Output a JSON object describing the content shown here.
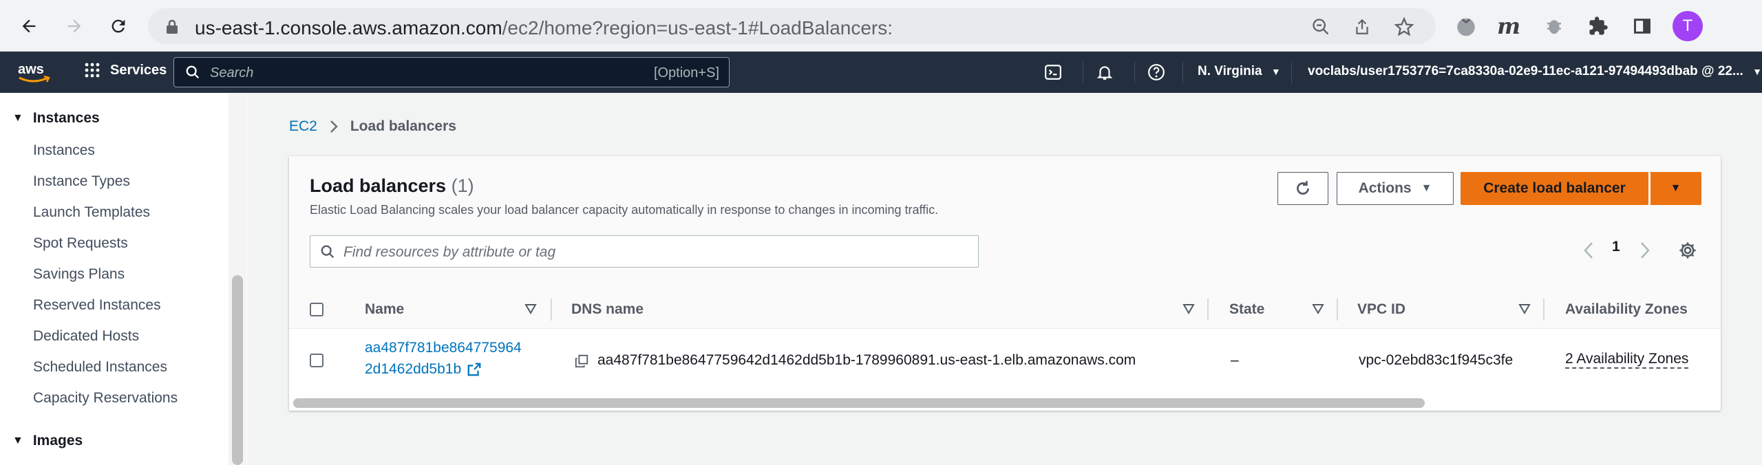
{
  "browser": {
    "url_host": "us-east-1.console.aws.amazon.com",
    "url_path": "/ec2/home?region=us-east-1#LoadBalancers:",
    "avatar_letter": "T"
  },
  "aws_nav": {
    "services_label": "Services",
    "search_placeholder": "Search",
    "search_shortcut": "[Option+S]",
    "region_label": "N. Virginia",
    "account_label": "voclabs/user1753776=7ca8330a-02e9-11ec-a121-97494493dbab @ 22..."
  },
  "sidebar": {
    "section_instances": "Instances",
    "items": [
      "Instances",
      "Instance Types",
      "Launch Templates",
      "Spot Requests",
      "Savings Plans",
      "Reserved Instances",
      "Dedicated Hosts",
      "Scheduled Instances",
      "Capacity Reservations"
    ],
    "section_images": "Images"
  },
  "breadcrumb": {
    "root": "EC2",
    "current": "Load balancers"
  },
  "panel": {
    "title": "Load balancers",
    "count": "(1)",
    "description": "Elastic Load Balancing scales your load balancer capacity automatically in response to changes in incoming traffic.",
    "actions_label": "Actions",
    "create_label": "Create load balancer",
    "filter_placeholder": "Find resources by attribute or tag",
    "page_number": "1"
  },
  "table": {
    "columns": [
      "Name",
      "DNS name",
      "State",
      "VPC ID",
      "Availability Zones"
    ],
    "rows": [
      {
        "name_line1": "aa487f781be864775964",
        "name_line2": "2d1462dd5b1b",
        "dns_name": "aa487f781be8647759642d1462dd5b1b-1789960891.us-east-1.elb.amazonaws.com",
        "state": "–",
        "vpc_id": "vpc-02ebd83c1f945c3fe",
        "availability_zones": "2 Availability Zones"
      }
    ]
  },
  "colors": {
    "aws_nav_bg": "#232f3e",
    "primary_button": "#ec7211",
    "link": "#0073bb"
  }
}
